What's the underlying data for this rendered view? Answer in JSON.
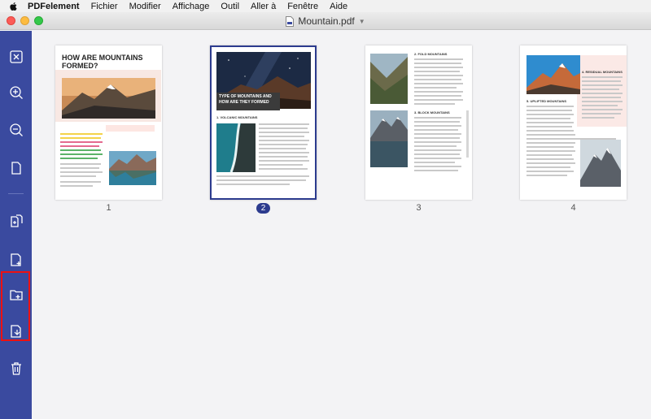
{
  "menubar": {
    "app": "PDFelement",
    "items": [
      "Fichier",
      "Modifier",
      "Affichage",
      "Outil",
      "Aller à",
      "Fenêtre",
      "Aide"
    ]
  },
  "window": {
    "title": "Mountain.pdf",
    "traffic_lights": [
      "#fc5b57",
      "#fdbc40",
      "#34c84a"
    ]
  },
  "toolbar": {
    "accent": "#3a4a9f",
    "highlight_color": "#e11111",
    "buttons": [
      "close-icon",
      "zoom-in-icon",
      "zoom-out-icon",
      "page-icon",
      "extract-icon",
      "insert-page-icon",
      "insert-from-file-icon",
      "replace-page-icon",
      "delete-icon"
    ]
  },
  "pages": [
    {
      "number": "1",
      "heading": "HOW ARE MOUNTAINS FORMED?",
      "selected": false
    },
    {
      "number": "2",
      "heading": "TYPE OF MOUNTAINS AND HOW ARE THEY FORMED",
      "subheading": "1. VOLCANIC MOUNTAINS",
      "selected": true
    },
    {
      "number": "3",
      "heading": "2. FOLD MOUNTAINS",
      "subheading": "3. BLOCK MOUNTAINS",
      "selected": false
    },
    {
      "number": "4",
      "heading": "4. RESIDUAL MOUNTAINS",
      "subheading": "5. UPLIFTED MOUNTAINS",
      "selected": false
    }
  ]
}
